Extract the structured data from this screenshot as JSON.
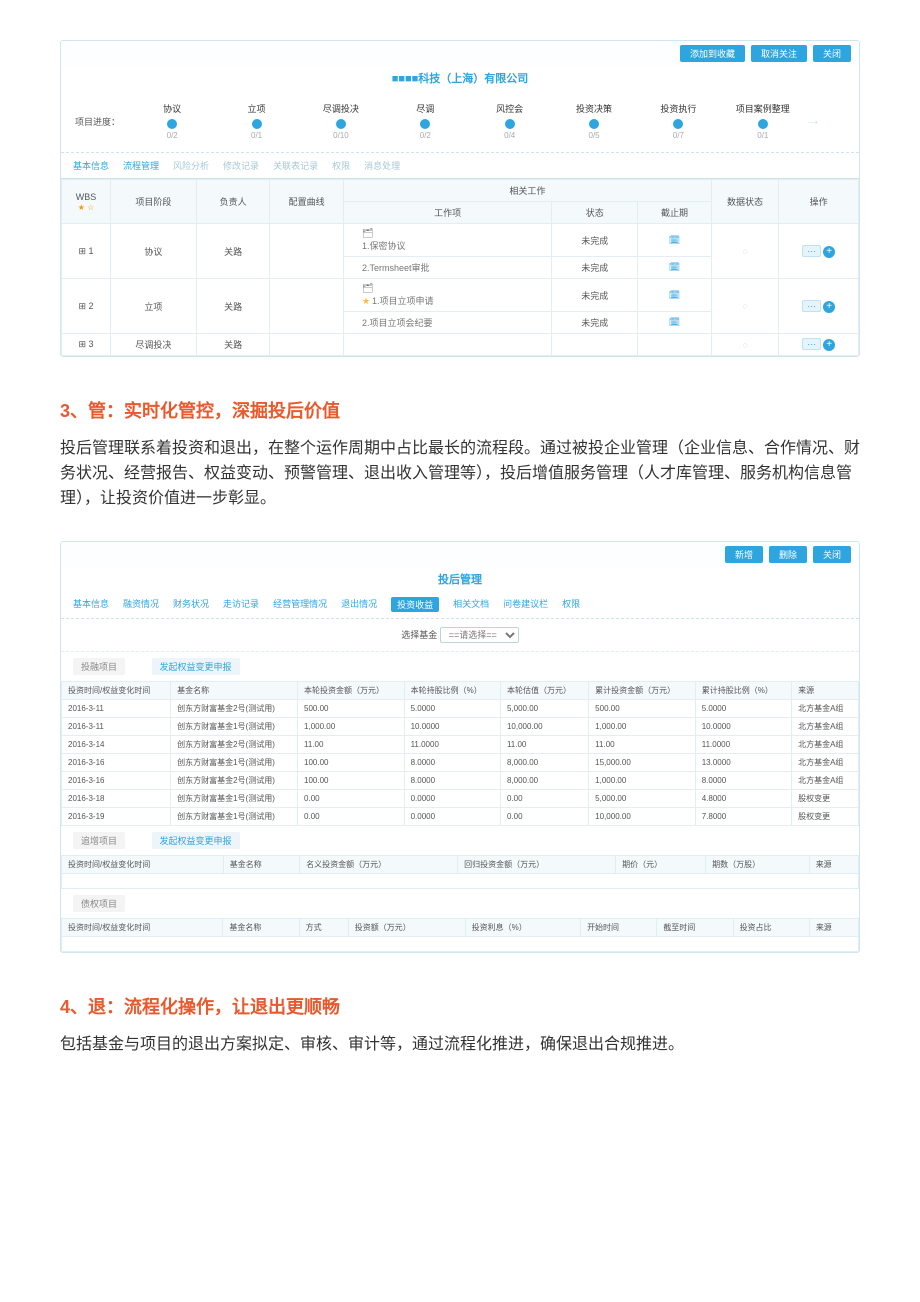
{
  "shot1": {
    "btn_favorite": "添加到收藏",
    "btn_focus": "取消关注",
    "btn_close": "关闭",
    "company": "■■■■科技（上海）有限公司",
    "steps_label": "项目进度：",
    "steps": [
      {
        "label": "协议",
        "count": "0/2"
      },
      {
        "label": "立项",
        "count": "0/1"
      },
      {
        "label": "尽调投决",
        "count": "0/10"
      },
      {
        "label": "尽调",
        "count": "0/2"
      },
      {
        "label": "风控会",
        "count": "0/4"
      },
      {
        "label": "投资决策",
        "count": "0/5"
      },
      {
        "label": "投资执行",
        "count": "0/7"
      },
      {
        "label": "项目案例整理",
        "count": "0/1"
      }
    ],
    "subtabs": [
      "基本信息",
      "流程管理",
      "风险分析",
      "修改记录",
      "关联表记录",
      "权限",
      "消息处理"
    ],
    "wbs_headers": {
      "wbs": "WBS",
      "stage": "项目阶段",
      "owner": "负责人",
      "team": "配置曲线",
      "related": "相关工作",
      "work": "工作项",
      "status": "状态",
      "deadline": "截止期",
      "data": "数据状态",
      "op": "操作"
    },
    "wbs_rows": [
      {
        "idx": "⊞ 1",
        "stage": "协议",
        "owner": "关路",
        "items": [
          {
            "name": "1.保密协议",
            "status": "未完成"
          },
          {
            "name": "2.Termsheet审批",
            "status": "未完成"
          }
        ]
      },
      {
        "idx": "⊞ 2",
        "stage": "立项",
        "owner": "关路",
        "items": [
          {
            "name": "1.项目立项申请",
            "status": "未完成",
            "star": true
          },
          {
            "name": "2.项目立项会纪要",
            "status": "未完成"
          }
        ]
      },
      {
        "idx": "⊞ 3",
        "stage": "尽调投决",
        "owner": "关路",
        "items": []
      }
    ],
    "icon_doc": "🗂"
  },
  "section3": {
    "title": "3、管：实时化管控，深掘投后价值",
    "body": "投后管理联系着投资和退出，在整个运作周期中占比最长的流程段。通过被投企业管理（企业信息、合作情况、财务状况、经营报告、权益变动、预警管理、退出收入管理等），投后增值服务管理（人才库管理、服务机构信息管理），让投资价值进一步彰显。"
  },
  "shot2": {
    "btn_new": "新增",
    "btn_del": "删除",
    "btn_close": "关闭",
    "title": "投后管理",
    "tabs": [
      "基本信息",
      "融资情况",
      "财务状况",
      "走访记录",
      "经营管理情况",
      "退出情况",
      "投资收益",
      "相关文档",
      "问卷建议栏",
      "权限"
    ],
    "active_tab": "投资收益",
    "select_label": "选择基金",
    "select_placeholder": "==请选择==",
    "tag1": "投融项目",
    "btn_rcalc": "发起权益变更申报",
    "cols1": [
      "投资时间/权益变化时间",
      "基金名称",
      "本轮投资金额（万元）",
      "本轮持股比例（%）",
      "本轮估值（万元）",
      "累计投资金额（万元）",
      "累计持股比例（%）",
      "来源"
    ],
    "rows1": [
      {
        "c": [
          "2016-3-11",
          "创东方财富基金2号(测试用)",
          "500.00",
          "5.0000",
          "5,000.00",
          "500.00",
          "5.0000",
          "北方基金A组"
        ]
      },
      {
        "c": [
          "2016-3-11",
          "创东方财富基金1号(测试用)",
          "1,000.00",
          "10.0000",
          "10,000.00",
          "1,000.00",
          "10.0000",
          "北方基金A组"
        ]
      },
      {
        "c": [
          "2016-3-14",
          "创东方财富基金2号(测试用)",
          "11.00",
          "11.0000",
          "11.00",
          "11.00",
          "11.0000",
          "北方基金A组"
        ]
      },
      {
        "c": [
          "2016-3-16",
          "创东方财富基金1号(测试用)",
          "100.00",
          "8.0000",
          "8,000.00",
          "15,000.00",
          "13.0000",
          "北方基金A组"
        ]
      },
      {
        "c": [
          "2016-3-16",
          "创东方财富基金2号(测试用)",
          "100.00",
          "8.0000",
          "8,000.00",
          "1,000.00",
          "8.0000",
          "北方基金A组"
        ]
      },
      {
        "c": [
          "2016-3-18",
          "创东方财富基金1号(测试用)",
          "0.00",
          "0.0000",
          "0.00",
          "5,000.00",
          "4.8000",
          "股权变更"
        ]
      },
      {
        "c": [
          "2016-3-19",
          "创东方财富基金1号(测试用)",
          "0.00",
          "0.0000",
          "0.00",
          "10,000.00",
          "7.8000",
          "股权变更"
        ]
      }
    ],
    "tag2": "追增项目",
    "btn_rcalc2": "发起权益变更申报",
    "cols2": [
      "投资时间/权益变化时间",
      "基金名称",
      "名义投资金额（万元）",
      "回归投资金额（万元）",
      "期价（元）",
      "期数（万股）",
      "来源"
    ],
    "tag3": "债权项目",
    "cols3": [
      "投资时间/权益变化时间",
      "基金名称",
      "方式",
      "投资额（万元）",
      "投资利息（%）",
      "开始时间",
      "截至时间",
      "投资占比",
      "来源"
    ]
  },
  "section4": {
    "title": "4、退：流程化操作，让退出更顺畅",
    "body": "包括基金与项目的退出方案拟定、审核、审计等，通过流程化推进，确保退出合规推进。"
  }
}
